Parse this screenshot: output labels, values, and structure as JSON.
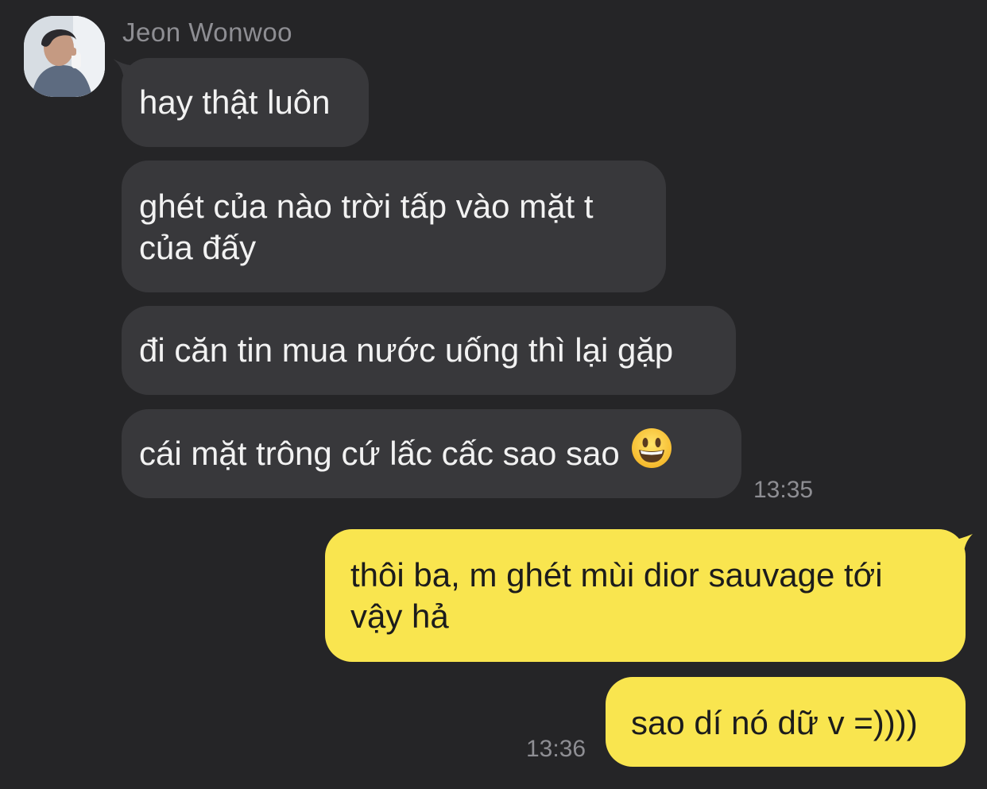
{
  "chat": {
    "sender_name": "Jeon Wonwoo",
    "incoming": [
      {
        "text": "hay thật luôn"
      },
      {
        "line1": "ghét của nào trời tấp vào mặt t",
        "line2": "của đấy"
      },
      {
        "text": "đi căn tin mua nước uống thì lại gặp"
      },
      {
        "text": "cái mặt trông cứ lấc cấc sao sao",
        "emoji": "grinning-face-emoji"
      }
    ],
    "incoming_time": "13:35",
    "outgoing": [
      {
        "line1": "thôi ba, m ghét mùi dior sauvage tới",
        "line2": "vậy hả"
      },
      {
        "text": "sao dí nó dữ v =))))"
      }
    ],
    "outgoing_time": "13:36"
  },
  "colors": {
    "background": "#252527",
    "incoming_bubble": "#38383b",
    "outgoing_bubble": "#f9e54f",
    "meta_text": "#8e8e93"
  }
}
